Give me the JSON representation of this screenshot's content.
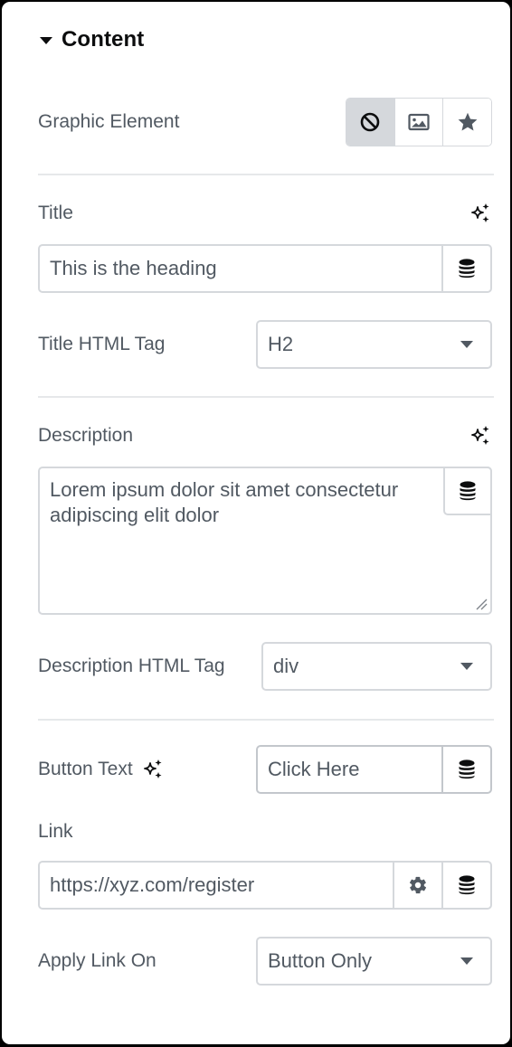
{
  "section": {
    "title": "Content",
    "expanded": true
  },
  "graphic_element": {
    "label": "Graphic Element",
    "options": [
      {
        "name": "none",
        "icon": "ban-icon",
        "active": true
      },
      {
        "name": "image",
        "icon": "image-icon",
        "active": false
      },
      {
        "name": "icon",
        "icon": "star-icon",
        "active": false
      }
    ]
  },
  "title": {
    "label": "Title",
    "value": "This is the heading",
    "ai_icon": "sparkle-icon",
    "dynamic_icon": "database-icon"
  },
  "title_tag": {
    "label": "Title HTML Tag",
    "value": "H2"
  },
  "description": {
    "label": "Description",
    "value": "Lorem ipsum dolor sit amet consectetur adipiscing elit dolor",
    "ai_icon": "sparkle-icon",
    "dynamic_icon": "database-icon"
  },
  "description_tag": {
    "label": "Description HTML Tag",
    "value": "div"
  },
  "button_text": {
    "label": "Button Text",
    "value": "Click Here",
    "ai_icon": "sparkle-icon",
    "dynamic_icon": "database-icon"
  },
  "link": {
    "label": "Link",
    "value": "https://xyz.com/register",
    "settings_icon": "gear-icon",
    "dynamic_icon": "database-icon"
  },
  "apply_link_on": {
    "label": "Apply Link On",
    "value": "Button Only"
  }
}
